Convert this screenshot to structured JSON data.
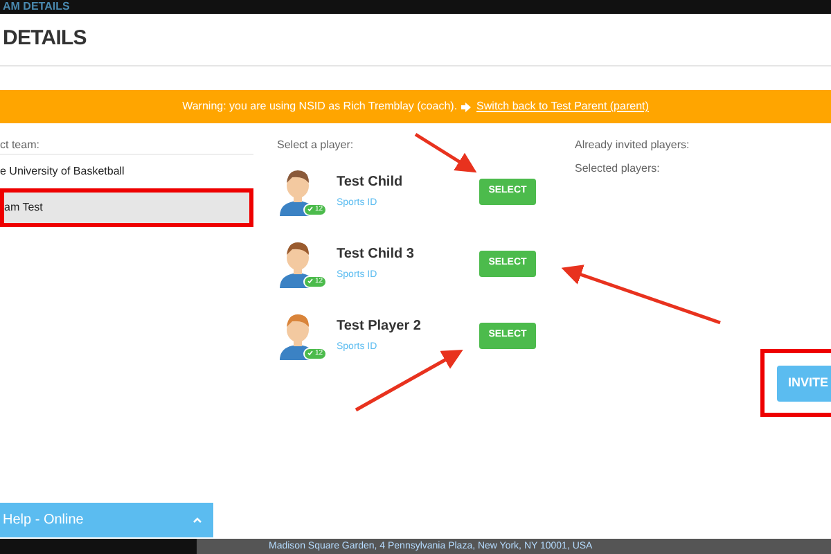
{
  "background_title": "AM DETAILS",
  "modal": {
    "title": "DETAILS"
  },
  "banner": {
    "warning": "Warning: you are using NSID as Rich Tremblay (coach).",
    "link": "Switch back to Test Parent (parent)"
  },
  "teams": {
    "label": "ct team:",
    "items": [
      {
        "name": "e University of Basketball",
        "selected": false
      },
      {
        "name": "am Test",
        "selected": true
      }
    ]
  },
  "players": {
    "label": "Select a player:",
    "items": [
      {
        "name": "Test Child",
        "sub": "Sports ID",
        "badge": "12",
        "button": "SELECT"
      },
      {
        "name": "Test Child 3",
        "sub": "Sports ID",
        "badge": "12",
        "button": "SELECT"
      },
      {
        "name": "Test Player 2",
        "sub": "Sports ID",
        "badge": "12",
        "button": "SELECT"
      }
    ]
  },
  "invited": {
    "already": "Already invited players:",
    "selected": "Selected players:"
  },
  "invite_button": "INVITE",
  "help": {
    "label": "Help - Online"
  },
  "footer": {
    "address": "Madison Square Garden, 4 Pennsylvania Plaza, New York, NY 10001, USA"
  }
}
